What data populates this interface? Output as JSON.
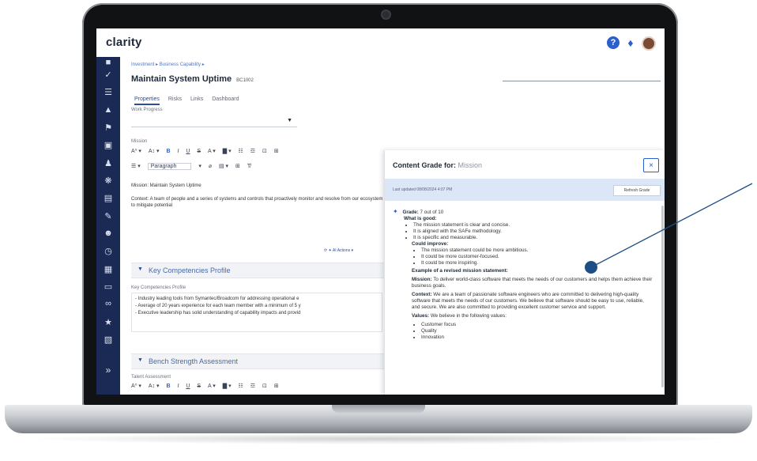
{
  "app": {
    "brand": "clarity"
  },
  "header": {
    "help_icon": "question-circle-icon",
    "notify_icon": "bell-icon",
    "avatar_icon": "user-avatar-icon"
  },
  "sidebar": {
    "icons": [
      "collapse-icon",
      "check-icon",
      "list-icon",
      "hierarchy-icon",
      "flag-icon",
      "briefcase-icon",
      "people-icon",
      "network-icon",
      "document-icon",
      "ruler-icon",
      "users-icon",
      "clock-icon",
      "chart-icon",
      "monitor-icon",
      "link-icon",
      "bank-icon",
      "folder-icon",
      "expand-icon"
    ]
  },
  "page": {
    "breadcrumb": "Investment  ▸  Business Capability  ▸",
    "title": "Maintain System Uptime",
    "id": "BC1002",
    "tabs": [
      "Properties",
      "Risks",
      "Links",
      "Dashboard"
    ],
    "work_progress_label": "Work Progress",
    "mission_label": "Mission",
    "toolbar1": [
      "A⁰ ▾",
      "A↕ ▾",
      "B",
      "I",
      "U",
      "S",
      "A ▾",
      "▇ ▾",
      "☷",
      "☲",
      "⊡",
      "⊞"
    ],
    "toolbar2": [
      "☰ ▾",
      "Paragraph",
      "▾",
      "⌀",
      "▤ ▾",
      "⊞",
      "T̸"
    ],
    "mission_text": "Mission: Maintain System Uptime",
    "context_text": "Context: A team of people and a series of systems and controls that proactively monitor and resolve from our ecosystem to mitigate potential",
    "ai_actions": "⟳  ✦ AI Actions ▾",
    "section1": "Key Competencies Profile",
    "kcp_label": "Key Competencies Profile",
    "kcp_lines": [
      "- Industry leading tools from Symantec/Broadcom for addressing operational e",
      "- Average of 20 years experience for each team member with a minimum of 5 y",
      "- Executive leadership has solid understanding of capability impacts and provid"
    ],
    "section2": "Bench Strength Assessment",
    "talent_label": "Talent Assessment"
  },
  "panel": {
    "title": "Content Grade for:",
    "title_field": "Mission",
    "close_label": "×",
    "last_updated": "Last updated 08/08/2024 4:07 PM",
    "refresh_label": "Refresh Grade",
    "grade_label": "Grade:",
    "grade_value": "7 out of 10",
    "good_heading": "What is good:",
    "good_items": [
      "The mission statement is clear and concise.",
      "It is aligned with the SAFe methodology.",
      "It is specific and measurable."
    ],
    "improve_heading": "Could improve:",
    "improve_items": [
      "The mission statement could be more ambitious.",
      "It could be more customer-focused.",
      "It could be more inspiring."
    ],
    "example_heading": "Example of a revised mission statement:",
    "mission_label": "Mission:",
    "mission_text": "To deliver world-class software that meets the needs of our customers and helps them achieve their business goals.",
    "context_label": "Context:",
    "context_text": "We are a team of passionate software engineers who are committed to delivering high-quality software that meets the needs of our customers. We believe that software should be easy to use, reliable, and secure. We are also committed to providing excellent customer service and support.",
    "values_label": "Values:",
    "values_text": "We believe in the following values:",
    "values_items": [
      "Customer focus",
      "Quality",
      "Innovation"
    ]
  },
  "colors": {
    "sidebar": "#1a2a55",
    "accent": "#2b5fd0",
    "callout": "#1d4f86"
  }
}
